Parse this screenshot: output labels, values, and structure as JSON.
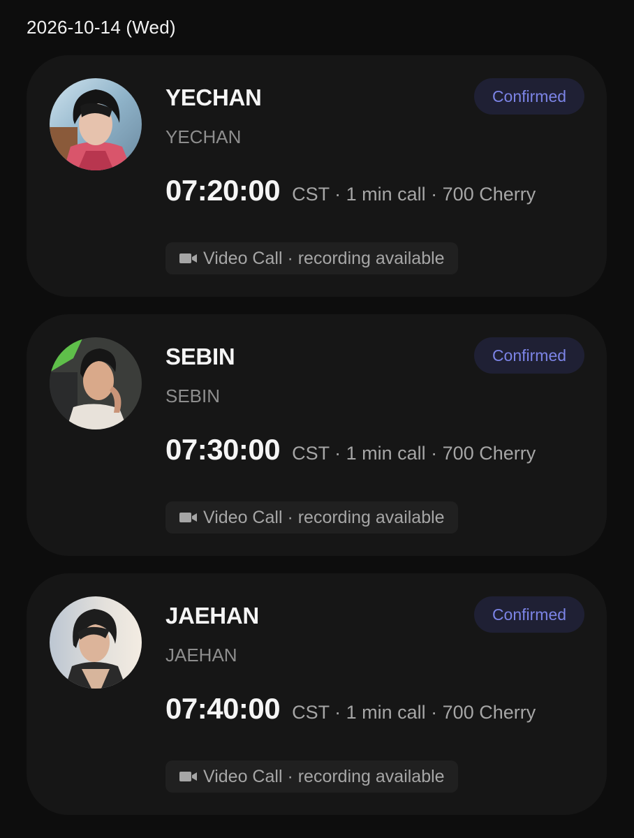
{
  "date_header": "2026-10-14 (Wed)",
  "colors": {
    "background": "#0d0d0d",
    "card": "#161616",
    "badge_bg": "#1f2034",
    "badge_text": "#7c84e6",
    "chip_bg": "#202020",
    "muted_text": "#a6a6a6"
  },
  "calls": [
    {
      "name": "YECHAN",
      "subname": "YECHAN",
      "status": "Confirmed",
      "time": "07:20:00",
      "details": "CST · 1 min call · 700 Cherry",
      "call_type": "Video Call · recording available",
      "icon": "video-camera-icon"
    },
    {
      "name": "SEBIN",
      "subname": "SEBIN",
      "status": "Confirmed",
      "time": "07:30:00",
      "details": "CST · 1 min call · 700 Cherry",
      "call_type": "Video Call · recording available",
      "icon": "video-camera-icon"
    },
    {
      "name": "JAEHAN",
      "subname": "JAEHAN",
      "status": "Confirmed",
      "time": "07:40:00",
      "details": "CST · 1 min call · 700 Cherry",
      "call_type": "Video Call · recording available",
      "icon": "video-camera-icon"
    }
  ]
}
